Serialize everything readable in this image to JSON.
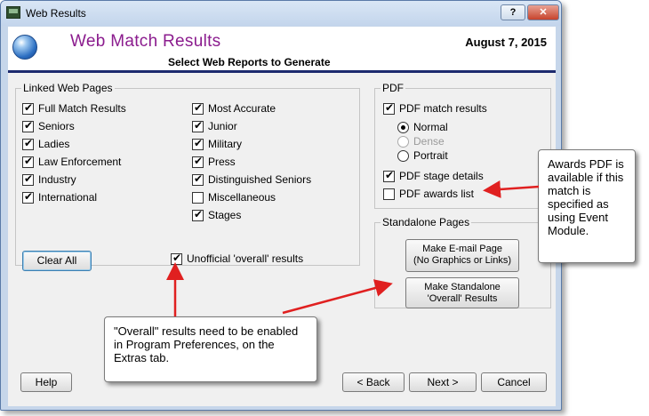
{
  "window": {
    "title": "Web Results",
    "help_btn": "?",
    "close_btn": "✕"
  },
  "header": {
    "title": "Web Match Results",
    "date": "August  7, 2015",
    "subtitle": "Select Web Reports to Generate"
  },
  "linked": {
    "label": "Linked Web Pages",
    "col1": [
      {
        "label": "Full Match Results",
        "checked": true
      },
      {
        "label": "Seniors",
        "checked": true
      },
      {
        "label": "Ladies",
        "checked": true
      },
      {
        "label": "Law Enforcement",
        "checked": true
      },
      {
        "label": "Industry",
        "checked": true
      },
      {
        "label": "International",
        "checked": true
      }
    ],
    "col2": [
      {
        "label": "Most Accurate",
        "checked": true
      },
      {
        "label": "Junior",
        "checked": true
      },
      {
        "label": "Military",
        "checked": true
      },
      {
        "label": "Press",
        "checked": true
      },
      {
        "label": "Distinguished Seniors",
        "checked": true
      },
      {
        "label": "Miscellaneous",
        "checked": false
      },
      {
        "label": "Stages",
        "checked": true
      }
    ],
    "clear_all": "Clear All",
    "unofficial": {
      "label": "Unofficial 'overall' results",
      "checked": true
    }
  },
  "pdf": {
    "label": "PDF",
    "match_results": {
      "label": "PDF match results",
      "checked": true
    },
    "radios": [
      {
        "label": "Normal",
        "selected": true,
        "disabled": false
      },
      {
        "label": "Dense",
        "selected": false,
        "disabled": true
      },
      {
        "label": "Portrait",
        "selected": false,
        "disabled": false
      }
    ],
    "stage_details": {
      "label": "PDF stage details",
      "checked": true
    },
    "awards_list": {
      "label": "PDF awards list",
      "checked": false
    }
  },
  "standalone": {
    "label": "Standalone Pages",
    "email_btn_line1": "Make E-mail Page",
    "email_btn_line2": "(No Graphics or Links)",
    "overall_btn_line1": "Make Standalone",
    "overall_btn_line2": "'Overall' Results"
  },
  "footer": {
    "help": "Help",
    "back": "< Back",
    "next": "Next >",
    "cancel": "Cancel"
  },
  "callouts": {
    "overall": "\"Overall\" results need to be enabled in Program Preferences, on the Extras tab.",
    "awards": "Awards PDF is available if this match is specified as using Event Module."
  },
  "colors": {
    "header_title": "#8b1c8e",
    "header_rule": "#1c2a6e",
    "arrow": "#e02020"
  }
}
